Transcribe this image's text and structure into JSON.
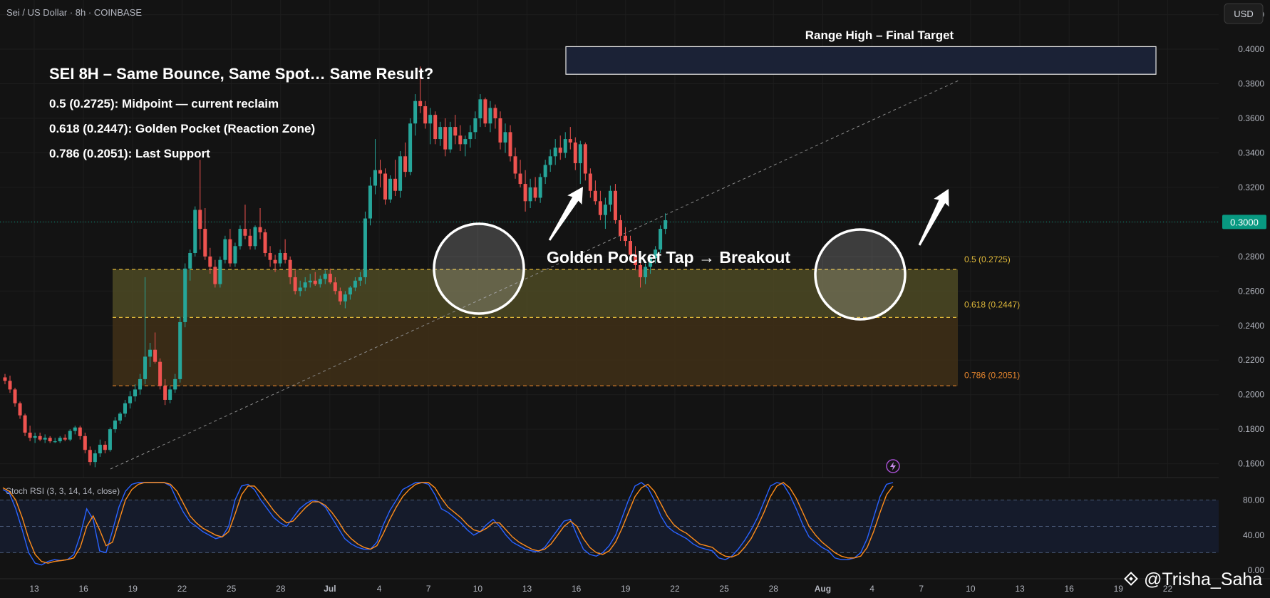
{
  "header": {
    "symbol_line": "Sei / US Dollar · 8h · COINBASE",
    "currency_button": "USD"
  },
  "annotations": {
    "headline": "SEI 8H – Same Bounce, Same Spot… Same Result?",
    "line1": "0.5 (0.2725): Midpoint — current reclaim",
    "line2": "0.618 (0.2447): Golden Pocket (Reaction Zone)",
    "line3": "0.786 (0.2051): Last Support",
    "target_label": "Range High – Final Target",
    "breakout_label": "Golden Pocket Tap → Breakout",
    "watermark": "@Trisha_Saha"
  },
  "colors": {
    "background": "#131313",
    "up": "#26a69a",
    "down": "#ef5350",
    "fib_line": "#e0b93a",
    "fib_05_zone": "#4d4a25",
    "fib_618_zone": "#3e2f17",
    "target_box": "#1b2236",
    "stoch_k": "#2962ff",
    "stoch_d": "#ff8c1a",
    "price_badge": "#089981"
  },
  "chart_data": {
    "type": "candlestick",
    "timeframe": "8h",
    "price_axis": {
      "ticks": [
        "0.4200",
        "0.4000",
        "0.3800",
        "0.3600",
        "0.3400",
        "0.3200",
        "0.3000",
        "0.2800",
        "0.2600",
        "0.2400",
        "0.2200",
        "0.2000",
        "0.1800",
        "0.1600"
      ],
      "range": [
        0.152,
        0.4285
      ]
    },
    "current_price": "0.3000",
    "fib_levels": [
      {
        "label": "0.5 (0.2725)",
        "price": 0.2725
      },
      {
        "label": "0.618 (0.2447)",
        "price": 0.2447
      },
      {
        "label": "0.786 (0.2051)",
        "price": 0.2051
      }
    ],
    "target_zone": {
      "low": 0.3855,
      "high": 0.4015
    },
    "time_axis": {
      "labels": [
        "13",
        "16",
        "19",
        "22",
        "25",
        "28",
        "Jul",
        "4",
        "7",
        "10",
        "13",
        "16",
        "19",
        "22",
        "25",
        "28",
        "Aug",
        "4",
        "7",
        "10",
        "13",
        "16",
        "19",
        "22"
      ]
    },
    "candles": [
      [
        0.21,
        0.212,
        0.206,
        0.208
      ],
      [
        0.208,
        0.211,
        0.201,
        0.203
      ],
      [
        0.203,
        0.204,
        0.193,
        0.195
      ],
      [
        0.195,
        0.196,
        0.186,
        0.188
      ],
      [
        0.188,
        0.189,
        0.176,
        0.178
      ],
      [
        0.178,
        0.182,
        0.173,
        0.175
      ],
      [
        0.175,
        0.178,
        0.172,
        0.176
      ],
      [
        0.176,
        0.178,
        0.173,
        0.174
      ],
      [
        0.174,
        0.177,
        0.172,
        0.175
      ],
      [
        0.175,
        0.176,
        0.172,
        0.173
      ],
      [
        0.173,
        0.175,
        0.172,
        0.173
      ],
      [
        0.173,
        0.176,
        0.172,
        0.175
      ],
      [
        0.175,
        0.177,
        0.173,
        0.174
      ],
      [
        0.174,
        0.18,
        0.173,
        0.179
      ],
      [
        0.179,
        0.182,
        0.177,
        0.181
      ],
      [
        0.181,
        0.182,
        0.174,
        0.176
      ],
      [
        0.176,
        0.178,
        0.166,
        0.168
      ],
      [
        0.168,
        0.17,
        0.159,
        0.161
      ],
      [
        0.161,
        0.168,
        0.158,
        0.166
      ],
      [
        0.166,
        0.174,
        0.164,
        0.171
      ],
      [
        0.171,
        0.173,
        0.166,
        0.168
      ],
      [
        0.168,
        0.181,
        0.167,
        0.18
      ],
      [
        0.18,
        0.187,
        0.178,
        0.185
      ],
      [
        0.185,
        0.19,
        0.183,
        0.189
      ],
      [
        0.189,
        0.197,
        0.187,
        0.195
      ],
      [
        0.195,
        0.202,
        0.192,
        0.199
      ],
      [
        0.199,
        0.206,
        0.196,
        0.203
      ],
      [
        0.203,
        0.212,
        0.2,
        0.209
      ],
      [
        0.209,
        0.268,
        0.206,
        0.222
      ],
      [
        0.222,
        0.23,
        0.216,
        0.226
      ],
      [
        0.226,
        0.236,
        0.218,
        0.219
      ],
      [
        0.219,
        0.221,
        0.203,
        0.205
      ],
      [
        0.205,
        0.209,
        0.194,
        0.197
      ],
      [
        0.197,
        0.205,
        0.195,
        0.203
      ],
      [
        0.203,
        0.212,
        0.201,
        0.209
      ],
      [
        0.209,
        0.245,
        0.207,
        0.242
      ],
      [
        0.242,
        0.276,
        0.239,
        0.273
      ],
      [
        0.273,
        0.284,
        0.266,
        0.282
      ],
      [
        0.282,
        0.309,
        0.28,
        0.307
      ],
      [
        0.307,
        0.336,
        0.284,
        0.296
      ],
      [
        0.296,
        0.308,
        0.278,
        0.28
      ],
      [
        0.28,
        0.285,
        0.27,
        0.274
      ],
      [
        0.274,
        0.278,
        0.262,
        0.264
      ],
      [
        0.264,
        0.28,
        0.262,
        0.278
      ],
      [
        0.278,
        0.292,
        0.276,
        0.29
      ],
      [
        0.29,
        0.296,
        0.274,
        0.276
      ],
      [
        0.276,
        0.288,
        0.274,
        0.286
      ],
      [
        0.286,
        0.298,
        0.284,
        0.296
      ],
      [
        0.296,
        0.31,
        0.29,
        0.292
      ],
      [
        0.292,
        0.296,
        0.284,
        0.286
      ],
      [
        0.286,
        0.298,
        0.284,
        0.297
      ],
      [
        0.297,
        0.308,
        0.29,
        0.294
      ],
      [
        0.294,
        0.296,
        0.28,
        0.282
      ],
      [
        0.282,
        0.286,
        0.274,
        0.278
      ],
      [
        0.278,
        0.281,
        0.271,
        0.276
      ],
      [
        0.276,
        0.284,
        0.274,
        0.282
      ],
      [
        0.282,
        0.29,
        0.276,
        0.278
      ],
      [
        0.278,
        0.28,
        0.264,
        0.268
      ],
      [
        0.268,
        0.272,
        0.258,
        0.26
      ],
      [
        0.26,
        0.266,
        0.257,
        0.262
      ],
      [
        0.262,
        0.268,
        0.26,
        0.265
      ],
      [
        0.265,
        0.27,
        0.262,
        0.266
      ],
      [
        0.266,
        0.271,
        0.263,
        0.264
      ],
      [
        0.264,
        0.269,
        0.262,
        0.267
      ],
      [
        0.267,
        0.272,
        0.264,
        0.27
      ],
      [
        0.27,
        0.273,
        0.264,
        0.265
      ],
      [
        0.265,
        0.268,
        0.258,
        0.26
      ],
      [
        0.26,
        0.262,
        0.252,
        0.254
      ],
      [
        0.254,
        0.26,
        0.25,
        0.258
      ],
      [
        0.258,
        0.263,
        0.255,
        0.262
      ],
      [
        0.262,
        0.268,
        0.26,
        0.266
      ],
      [
        0.266,
        0.271,
        0.263,
        0.268
      ],
      [
        0.268,
        0.306,
        0.264,
        0.302
      ],
      [
        0.302,
        0.326,
        0.298,
        0.321
      ],
      [
        0.321,
        0.348,
        0.316,
        0.33
      ],
      [
        0.33,
        0.336,
        0.32,
        0.328
      ],
      [
        0.328,
        0.331,
        0.31,
        0.313
      ],
      [
        0.313,
        0.327,
        0.311,
        0.325
      ],
      [
        0.325,
        0.336,
        0.315,
        0.318
      ],
      [
        0.318,
        0.341,
        0.314,
        0.338
      ],
      [
        0.338,
        0.346,
        0.326,
        0.329
      ],
      [
        0.329,
        0.36,
        0.327,
        0.357
      ],
      [
        0.357,
        0.374,
        0.35,
        0.37
      ],
      [
        0.37,
        0.39,
        0.363,
        0.367
      ],
      [
        0.367,
        0.37,
        0.354,
        0.357
      ],
      [
        0.357,
        0.366,
        0.345,
        0.362
      ],
      [
        0.362,
        0.364,
        0.345,
        0.348
      ],
      [
        0.348,
        0.358,
        0.344,
        0.355
      ],
      [
        0.355,
        0.36,
        0.338,
        0.342
      ],
      [
        0.342,
        0.358,
        0.34,
        0.355
      ],
      [
        0.355,
        0.362,
        0.345,
        0.35
      ],
      [
        0.35,
        0.356,
        0.341,
        0.345
      ],
      [
        0.345,
        0.35,
        0.338,
        0.348
      ],
      [
        0.348,
        0.356,
        0.343,
        0.352
      ],
      [
        0.352,
        0.364,
        0.348,
        0.36
      ],
      [
        0.36,
        0.374,
        0.355,
        0.371
      ],
      [
        0.371,
        0.372,
        0.355,
        0.357
      ],
      [
        0.357,
        0.37,
        0.352,
        0.366
      ],
      [
        0.366,
        0.368,
        0.354,
        0.36
      ],
      [
        0.36,
        0.364,
        0.342,
        0.346
      ],
      [
        0.346,
        0.357,
        0.34,
        0.352
      ],
      [
        0.352,
        0.356,
        0.335,
        0.338
      ],
      [
        0.338,
        0.343,
        0.325,
        0.328
      ],
      [
        0.328,
        0.336,
        0.32,
        0.322
      ],
      [
        0.322,
        0.33,
        0.306,
        0.312
      ],
      [
        0.312,
        0.325,
        0.308,
        0.32
      ],
      [
        0.32,
        0.326,
        0.312,
        0.314
      ],
      [
        0.314,
        0.328,
        0.311,
        0.326
      ],
      [
        0.326,
        0.336,
        0.322,
        0.333
      ],
      [
        0.333,
        0.342,
        0.329,
        0.338
      ],
      [
        0.338,
        0.348,
        0.333,
        0.343
      ],
      [
        0.343,
        0.35,
        0.336,
        0.34
      ],
      [
        0.34,
        0.352,
        0.337,
        0.348
      ],
      [
        0.348,
        0.355,
        0.342,
        0.346
      ],
      [
        0.346,
        0.349,
        0.33,
        0.334
      ],
      [
        0.334,
        0.347,
        0.322,
        0.345
      ],
      [
        0.345,
        0.346,
        0.324,
        0.328
      ],
      [
        0.328,
        0.331,
        0.314,
        0.318
      ],
      [
        0.318,
        0.324,
        0.31,
        0.312
      ],
      [
        0.312,
        0.318,
        0.301,
        0.304
      ],
      [
        0.304,
        0.314,
        0.296,
        0.31
      ],
      [
        0.31,
        0.321,
        0.306,
        0.318
      ],
      [
        0.318,
        0.322,
        0.299,
        0.301
      ],
      [
        0.301,
        0.304,
        0.289,
        0.292
      ],
      [
        0.292,
        0.297,
        0.286,
        0.289
      ],
      [
        0.289,
        0.292,
        0.278,
        0.281
      ],
      [
        0.281,
        0.286,
        0.272,
        0.275
      ],
      [
        0.275,
        0.277,
        0.262,
        0.268
      ],
      [
        0.268,
        0.276,
        0.264,
        0.274
      ],
      [
        0.274,
        0.281,
        0.27,
        0.279
      ],
      [
        0.279,
        0.286,
        0.276,
        0.284
      ],
      [
        0.284,
        0.298,
        0.282,
        0.296
      ],
      [
        0.296,
        0.305,
        0.293,
        0.301
      ]
    ],
    "indicator": {
      "name": "Stoch RSI (3, 3, 14, 14, close)",
      "range": [
        0,
        100
      ],
      "ticks": [
        "80.00",
        "40.00",
        "0.00"
      ],
      "bands": [
        20,
        50,
        80
      ],
      "series": [
        {
          "name": "K",
          "color": "#2962ff",
          "values": [
            92,
            88,
            70,
            46,
            20,
            8,
            6,
            10,
            12,
            11,
            12,
            18,
            40,
            70,
            58,
            22,
            20,
            45,
            72,
            90,
            98,
            100,
            100,
            100,
            100,
            100,
            96,
            80,
            66,
            55,
            50,
            44,
            40,
            36,
            38,
            50,
            80,
            96,
            98,
            92,
            80,
            70,
            60,
            54,
            50,
            60,
            70,
            76,
            80,
            78,
            72,
            60,
            48,
            36,
            30,
            26,
            24,
            24,
            32,
            52,
            68,
            80,
            92,
            96,
            100,
            100,
            98,
            86,
            70,
            66,
            60,
            54,
            46,
            40,
            44,
            52,
            58,
            50,
            40,
            32,
            28,
            24,
            22,
            21,
            26,
            36,
            46,
            56,
            58,
            40,
            24,
            18,
            16,
            20,
            28,
            40,
            60,
            80,
            96,
            100,
            94,
            80,
            62,
            50,
            44,
            40,
            36,
            30,
            26,
            24,
            22,
            14,
            12,
            16,
            24,
            34,
            46,
            60,
            78,
            96,
            100,
            98,
            86,
            70,
            52,
            38,
            32,
            26,
            22,
            14,
            12,
            12,
            14,
            20,
            36,
            60,
            84,
            98,
            100
          ]
        },
        {
          "name": "D",
          "color": "#ff8c1a",
          "values": [
            94,
            90,
            80,
            60,
            36,
            18,
            10,
            8,
            10,
            11,
            12,
            14,
            26,
            50,
            62,
            46,
            28,
            32,
            56,
            80,
            92,
            98,
            100,
            100,
            100,
            100,
            98,
            90,
            76,
            62,
            54,
            48,
            44,
            40,
            38,
            44,
            64,
            86,
            96,
            96,
            88,
            78,
            68,
            60,
            54,
            56,
            64,
            72,
            78,
            78,
            74,
            66,
            56,
            44,
            36,
            30,
            26,
            24,
            28,
            42,
            58,
            72,
            84,
            92,
            98,
            100,
            100,
            94,
            82,
            72,
            66,
            60,
            52,
            46,
            44,
            48,
            54,
            54,
            46,
            38,
            32,
            28,
            24,
            22,
            24,
            30,
            40,
            50,
            56,
            50,
            36,
            26,
            20,
            18,
            22,
            32,
            48,
            66,
            84,
            94,
            98,
            90,
            76,
            62,
            52,
            46,
            42,
            36,
            30,
            28,
            26,
            20,
            16,
            15,
            18,
            26,
            36,
            50,
            66,
            84,
            96,
            100,
            94,
            82,
            66,
            50,
            40,
            32,
            26,
            20,
            16,
            14,
            14,
            16,
            26,
            44,
            66,
            86,
            96
          ]
        }
      ]
    }
  }
}
